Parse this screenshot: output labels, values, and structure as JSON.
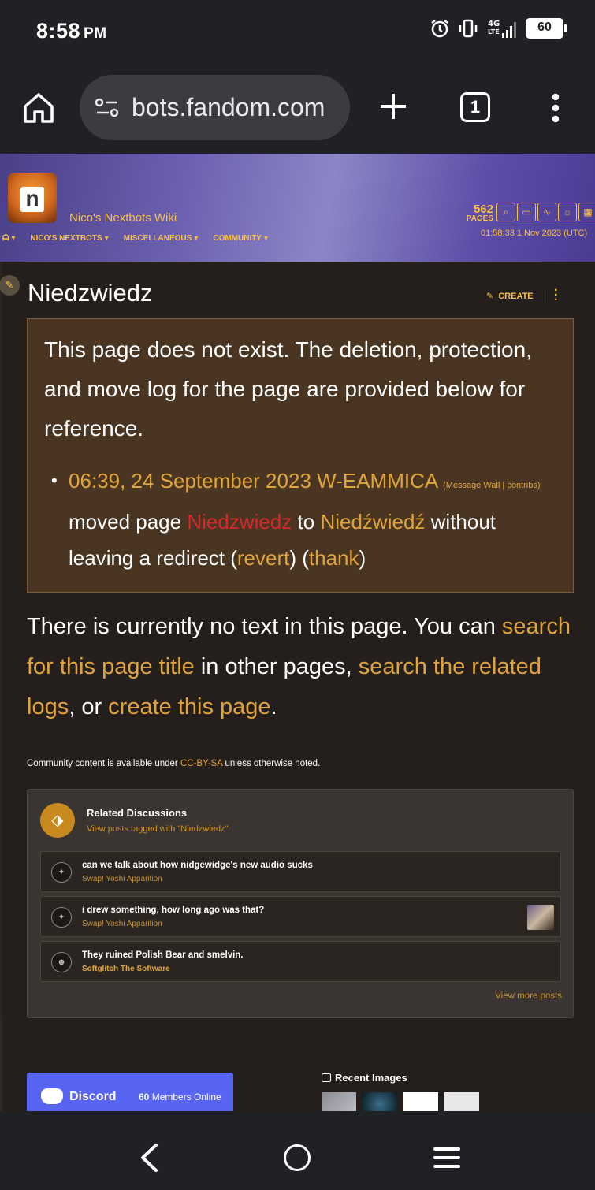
{
  "status_bar": {
    "time": "8:58",
    "ampm": "PM",
    "battery": "60",
    "network": "4G LTE"
  },
  "browser": {
    "url": "bots.fandom.com",
    "tab_count": "1"
  },
  "wiki": {
    "name": "Nico's Nextbots Wiki",
    "nav": [
      "NICO'S NEXTBOTS",
      "MISCELLANEOUS",
      "COMMUNITY"
    ],
    "pages_count": "562",
    "pages_label": "PAGES",
    "header_time": "01:58:33 1 Nov 2023 (UTC)"
  },
  "page": {
    "title": "Niedzwiedz",
    "create_label": "CREATE",
    "notice_text": "This page does not exist. The deletion, protection, and move log for the page are provided below for reference.",
    "log": {
      "timestamp": "06:39, 24 September 2023",
      "user": "W-EAMMICA",
      "message_wall": "Message Wall",
      "contribs": "contribs",
      "action": "moved page",
      "from_page": "Niedzwiedz",
      "to_word": "to",
      "to_page": "Niedźwiedź",
      "suffix": "without leaving a redirect",
      "revert": "revert",
      "thank": "thank"
    },
    "no_text": {
      "intro": "There is currently no text in this page. You can",
      "link1": "search for this page title",
      "mid": "in other pages,",
      "link2": "search the related logs",
      "or": ", or",
      "link3": "create this page",
      "end": "."
    },
    "license": {
      "prefix": "Community content is available under",
      "link": "CC-BY-SA",
      "suffix": "unless otherwise noted."
    }
  },
  "discussions": {
    "title": "Related Discussions",
    "subtitle": "View posts tagged with \"Niedzwiedz\"",
    "posts": [
      {
        "title": "can we talk about how nidgewidge's new audio sucks",
        "author": "Swap! Yoshi Apparition"
      },
      {
        "title": "i drew something, how long ago was that?",
        "author": "Swap! Yoshi Apparition"
      },
      {
        "title": "They ruined Polish Bear and smelvin.",
        "author": "Softglitch The Software"
      }
    ],
    "view_more": "View more posts"
  },
  "footer": {
    "discord_label": "Discord",
    "discord_members_count": "60",
    "discord_members_label": "Members Online",
    "recent_images_label": "Recent Images"
  },
  "colors": {
    "accent_gold": "#e0a53a",
    "missing_link_red": "#d6272b",
    "notice_bg": "#4a3522",
    "discord": "#5865f2"
  }
}
